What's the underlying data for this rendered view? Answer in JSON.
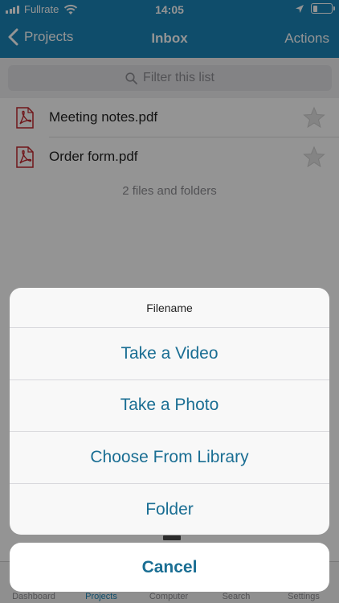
{
  "status_bar": {
    "carrier": "Fullrate",
    "time": "14:05",
    "battery_level": 0.25
  },
  "nav": {
    "back_label": "Projects",
    "title": "Inbox",
    "actions_label": "Actions"
  },
  "search": {
    "placeholder": "Filter this list"
  },
  "files": [
    {
      "name": "Meeting notes.pdf",
      "icon": "pdf-icon",
      "starred": false
    },
    {
      "name": "Order form.pdf",
      "icon": "pdf-icon",
      "starred": false
    }
  ],
  "file_count": "2 files and folders",
  "tab_bar": {
    "tabs": [
      {
        "label": "Dashboard"
      },
      {
        "label": "Projects"
      },
      {
        "label": "Computer"
      },
      {
        "label": "Search"
      },
      {
        "label": "Settings"
      }
    ]
  },
  "action_sheet": {
    "title": "Filename",
    "options": [
      {
        "label": "Take a Video"
      },
      {
        "label": "Take a Photo"
      },
      {
        "label": "Choose From Library"
      },
      {
        "label": "Folder"
      }
    ],
    "cancel_label": "Cancel"
  },
  "colors": {
    "brand": "#1a86b8",
    "action_text": "#1a6e93",
    "pdf_red": "#c1272d"
  }
}
